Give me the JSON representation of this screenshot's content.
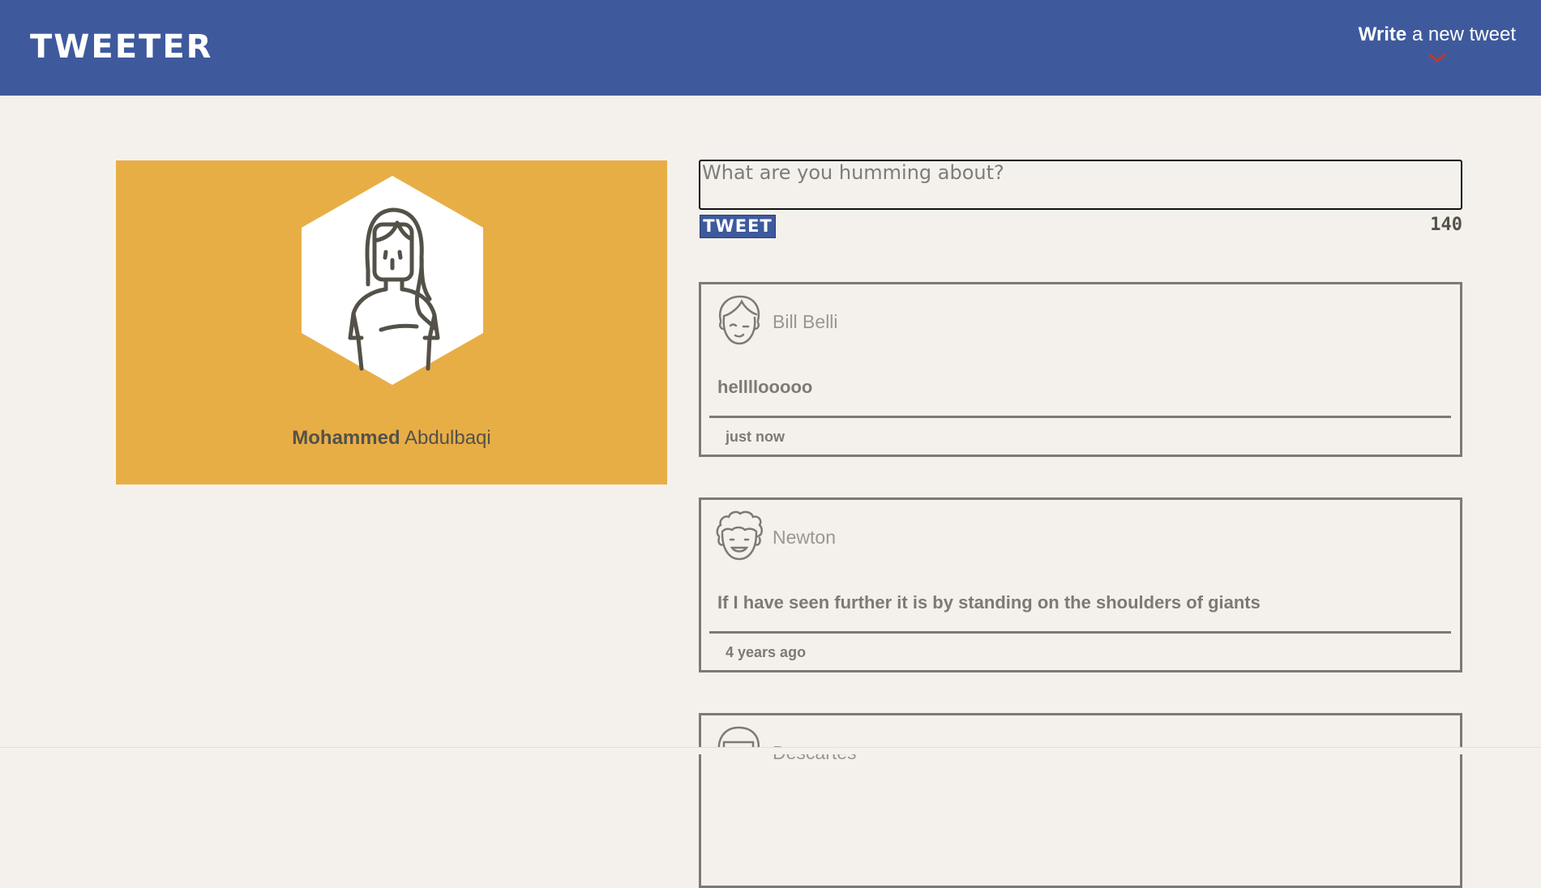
{
  "colors": {
    "nav_bg": "#3e5a9d",
    "profile_bg": "#e8ae46",
    "page_bg": "#f4f1ec",
    "chevron": "#c0392b",
    "tweet_border": "#7d7a75"
  },
  "nav": {
    "brand": "TWEETER",
    "compose_bold": "Write",
    "compose_rest": " a new tweet",
    "toggle_icon": "chevron-down-icon"
  },
  "profile": {
    "avatar_icon": "female-avatar-icon",
    "first_name": "Mohammed",
    "last_name": "Abdulbaqi"
  },
  "composer": {
    "placeholder": "What are you humming about?",
    "button_label": "TWEET",
    "counter": "140"
  },
  "tweets": [
    {
      "avatar_icon": "male-avatar-icon",
      "author": "Bill Belli",
      "content": "hellllooooo",
      "time": "just now"
    },
    {
      "avatar_icon": "curly-hair-avatar-icon",
      "author": "Newton",
      "content": "If I have seen further it is by standing on the shoulders of giants",
      "time": "4 years ago"
    },
    {
      "avatar_icon": "avatar-icon",
      "author": "Descartes",
      "content": "",
      "time": ""
    }
  ]
}
